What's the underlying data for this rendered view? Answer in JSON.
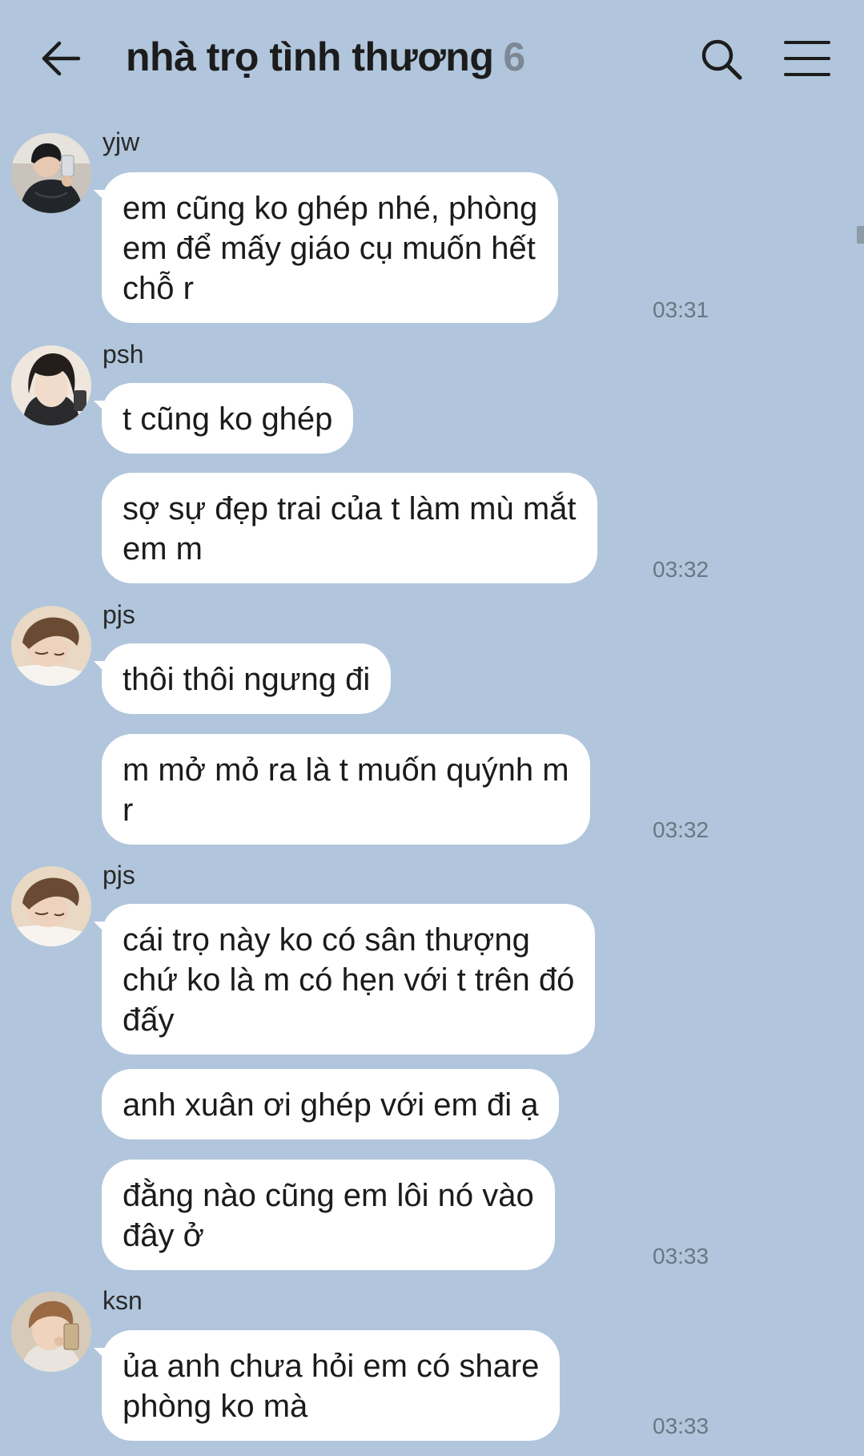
{
  "header": {
    "title": "nhà trọ tình thương",
    "member_count": "6"
  },
  "messages": [
    {
      "sender": "yjw",
      "bubbles": [
        "em cũng ko ghép nhé, phòng\nem để mấy giáo cụ muốn hết\nchỗ r"
      ],
      "time": "03:31"
    },
    {
      "sender": "psh",
      "bubbles": [
        "t cũng ko ghép",
        "sợ sự đẹp trai của t làm mù mắt\nem m"
      ],
      "time": "03:32"
    },
    {
      "sender": "pjs",
      "bubbles": [
        "thôi thôi ngưng đi",
        "m mở mỏ ra là t muốn quýnh m\nr"
      ],
      "time": "03:32"
    },
    {
      "sender": "pjs",
      "bubbles": [
        "cái trọ này ko có sân thượng\nchứ ko là m có hẹn với t trên đó\nđấy",
        "anh xuân ơi ghép với em đi ạ",
        "đằng nào cũng em lôi nó vào\nđây ở"
      ],
      "time": "03:33"
    },
    {
      "sender": "ksn",
      "bubbles": [
        "ủa anh chưa hỏi em có share\nphòng ko mà"
      ],
      "time": "03:33"
    }
  ],
  "colors": {
    "background": "#b1c6dc",
    "bubble": "#ffffff",
    "muted": "#7d8894"
  },
  "icons": {
    "back": "arrow-left-icon",
    "search": "search-icon",
    "menu": "hamburger-menu-icon"
  }
}
